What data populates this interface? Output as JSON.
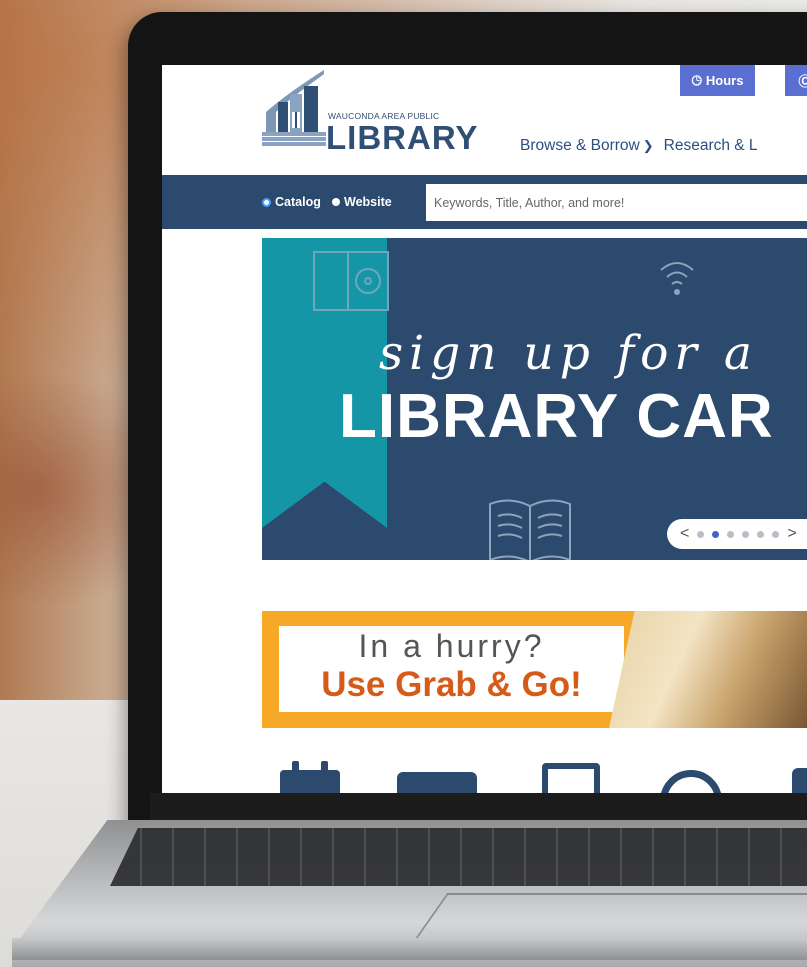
{
  "topbar": {
    "hours_label": "Hours",
    "next_label": "Ⓒ"
  },
  "logo": {
    "top_text": "WAUCONDA AREA PUBLIC",
    "main_text": "LIBRARY"
  },
  "nav": {
    "items": [
      {
        "label": "Browse & Borrow",
        "has_chevron": true
      },
      {
        "label": "Research & L",
        "has_chevron": false
      }
    ]
  },
  "search": {
    "options": [
      {
        "label": "Catalog",
        "selected": true
      },
      {
        "label": "Website",
        "selected": false
      }
    ],
    "placeholder": "Keywords, Title, Author, and more!"
  },
  "hero": {
    "line1": "sign up for a",
    "line2": "LIBRARY CAR",
    "pager": {
      "prev": "<",
      "next": ">",
      "slide_count": 6,
      "active_slide": 2
    }
  },
  "promo": {
    "line1": "In a hurry?",
    "line2": "Use Grab & Go!"
  },
  "colors": {
    "brand_navy": "#2b4a6d",
    "button_blue": "#5b6fd3",
    "nav_blue": "#2c4e82",
    "ribbon_teal": "#1596a6",
    "promo_orange": "#f6a826",
    "promo_text_orange": "#d65a18"
  },
  "icons": [
    "clock-icon",
    "calendar-icon",
    "card-icon",
    "document-icon",
    "search-circle-icon"
  ]
}
